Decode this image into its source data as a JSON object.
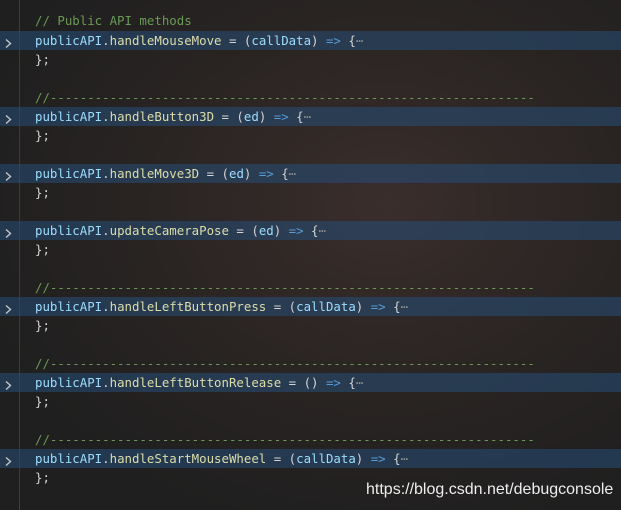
{
  "lines": {
    "l1": {
      "comment": "// Public API methods"
    },
    "l2": {
      "obj": "publicAPI",
      "dot": ".",
      "method": "handleMouseMove",
      "eq": " = (",
      "param": "callData",
      "close": ") ",
      "arrow": "=>",
      "brace": " {",
      "ellipsis": "⋯"
    },
    "l3": {
      "text": "};"
    },
    "l5": {
      "comment": "//-----------------------------------------------------------------"
    },
    "l6": {
      "obj": "publicAPI",
      "dot": ".",
      "method": "handleButton3D",
      "eq": " = (",
      "param": "ed",
      "close": ") ",
      "arrow": "=>",
      "brace": " {",
      "ellipsis": "⋯"
    },
    "l7": {
      "text": "};"
    },
    "l9": {
      "obj": "publicAPI",
      "dot": ".",
      "method": "handleMove3D",
      "eq": " = (",
      "param": "ed",
      "close": ") ",
      "arrow": "=>",
      "brace": " {",
      "ellipsis": "⋯"
    },
    "l10": {
      "text": "};"
    },
    "l12": {
      "obj": "publicAPI",
      "dot": ".",
      "method": "updateCameraPose",
      "eq": " = (",
      "param": "ed",
      "close": ") ",
      "arrow": "=>",
      "brace": " {",
      "ellipsis": "⋯"
    },
    "l13": {
      "text": "};"
    },
    "l15": {
      "comment": "//-----------------------------------------------------------------"
    },
    "l16": {
      "obj": "publicAPI",
      "dot": ".",
      "method": "handleLeftButtonPress",
      "eq": " = (",
      "param": "callData",
      "close": ") ",
      "arrow": "=>",
      "brace": " {",
      "ellipsis": "⋯"
    },
    "l17": {
      "text": "};"
    },
    "l19": {
      "comment": "//-----------------------------------------------------------------"
    },
    "l20": {
      "obj": "publicAPI",
      "dot": ".",
      "method": "handleLeftButtonRelease",
      "eq": " = ",
      "param": "",
      "close": "() ",
      "arrow": "=>",
      "brace": " {",
      "ellipsis": "⋯"
    },
    "l21": {
      "text": "};"
    },
    "l23": {
      "comment": "//-----------------------------------------------------------------"
    },
    "l24": {
      "obj": "publicAPI",
      "dot": ".",
      "method": "handleStartMouseWheel",
      "eq": " = (",
      "param": "callData",
      "close": ") ",
      "arrow": "=>",
      "brace": " {",
      "ellipsis": "⋯"
    },
    "l25": {
      "text": "};"
    }
  },
  "watermark": "https://blog.csdn.net/debugconsole",
  "icons": {
    "fold": "chevron-right-icon"
  },
  "colors": {
    "comment": "#6a9955",
    "variable": "#9cdcfe",
    "function": "#dcdcaa",
    "keyword": "#569cd6",
    "fold_highlight": "#264f78"
  }
}
